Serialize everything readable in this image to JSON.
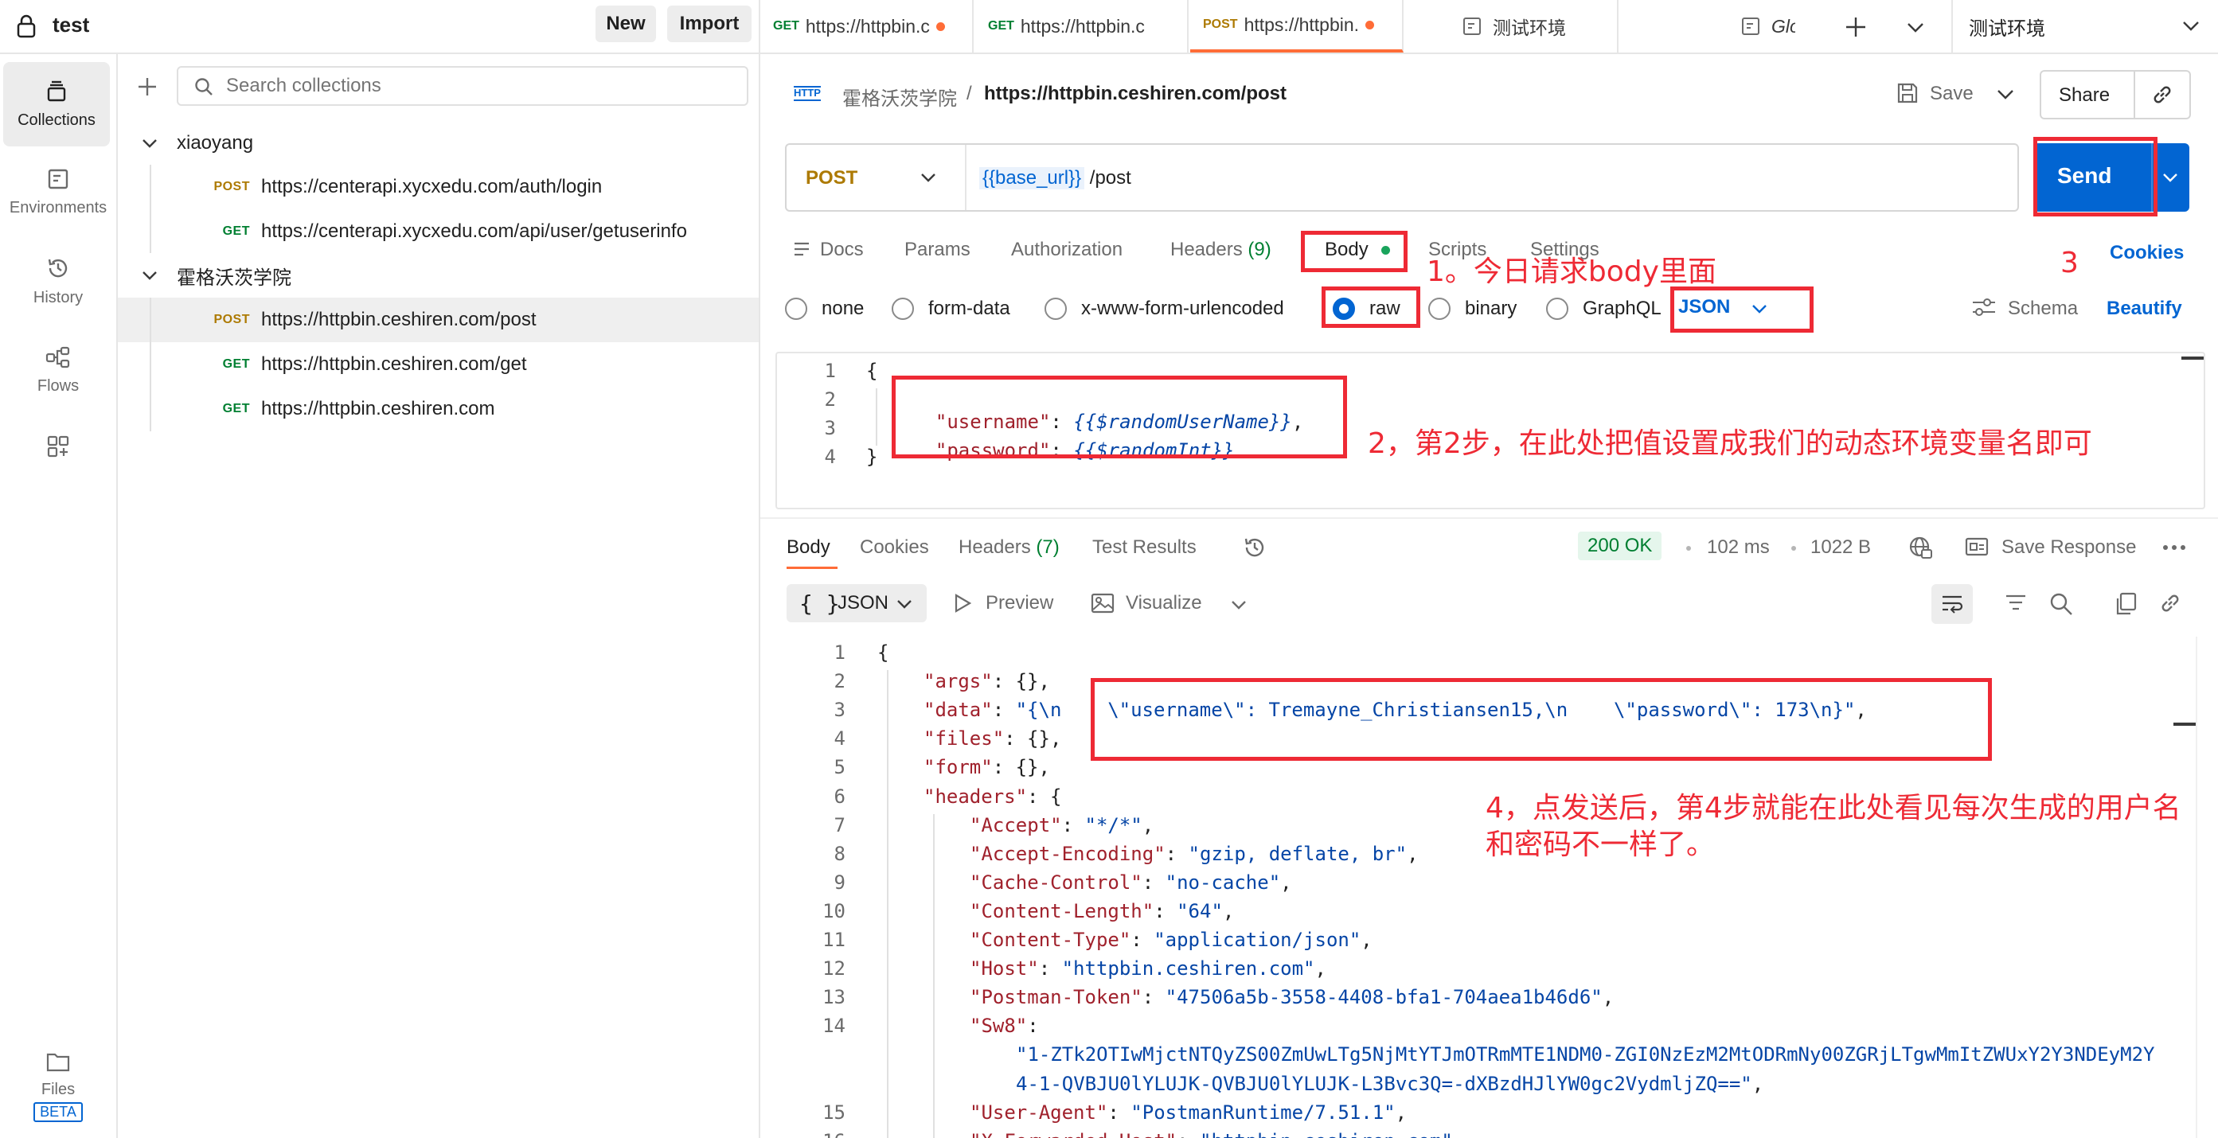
{
  "workspace": {
    "name": "test",
    "new_label": "New",
    "import_label": "Import"
  },
  "rail": {
    "collections": "Collections",
    "environments": "Environments",
    "history": "History",
    "flows": "Flows",
    "files": "Files",
    "beta": "BETA"
  },
  "sidebar": {
    "search_placeholder": "Search collections",
    "folders": [
      {
        "name": "xiaoyang",
        "requests": [
          {
            "method": "POST",
            "url": "https://centerapi.xycxedu.com/auth/login"
          },
          {
            "method": "GET",
            "url": "https://centerapi.xycxedu.com/api/user/getuserinfo"
          }
        ]
      },
      {
        "name": "霍格沃茨学院",
        "requests": [
          {
            "method": "POST",
            "url": "https://httpbin.ceshiren.com/post"
          },
          {
            "method": "GET",
            "url": "https://httpbin.ceshiren.com/get"
          },
          {
            "method": "GET",
            "url": "https://httpbin.ceshiren.com"
          }
        ]
      }
    ]
  },
  "tabs": [
    {
      "method": "GET",
      "label": "https://httpbin.c"
    },
    {
      "method": "GET",
      "label": "https://httpbin.c"
    },
    {
      "method": "POST",
      "label": "https://httpbin."
    }
  ],
  "env_tabs": {
    "env_name": "测试环境",
    "globals": "Globals",
    "selected_env": "测试环境"
  },
  "request": {
    "breadcrumb_collection": "霍格沃茨学院",
    "breadcrumb_sep": "/",
    "breadcrumb_name": "https://httpbin.ceshiren.com/post",
    "http_badge": "HTTP",
    "save_label": "Save",
    "share_label": "Share",
    "method": "POST",
    "url_var": "{{base_url}}",
    "url_path": " /post",
    "send_label": "Send",
    "tabs": {
      "docs": "Docs",
      "params": "Params",
      "authorization": "Authorization",
      "headers": "Headers",
      "headers_count": "(9)",
      "body": "Body",
      "scripts": "Scripts",
      "settings": "Settings",
      "cookies": "Cookies"
    },
    "body_types": {
      "none": "none",
      "form_data": "form-data",
      "urlencoded": "x-www-form-urlencoded",
      "raw": "raw",
      "binary": "binary",
      "graphql": "GraphQL",
      "format": "JSON",
      "schema": "Schema",
      "beautify": "Beautify"
    },
    "body_lines": [
      {
        "n": "1",
        "text": "{"
      },
      {
        "n": "2",
        "key": "\"username\"",
        "sep": ": ",
        "val": "{{$randomUserName}}",
        "end": ","
      },
      {
        "n": "3",
        "key": "\"password\"",
        "sep": ": ",
        "val": "{{$randomInt}}",
        "end": ""
      },
      {
        "n": "4",
        "text": "}"
      }
    ]
  },
  "response": {
    "tabs": {
      "body": "Body",
      "cookies": "Cookies",
      "headers": "Headers",
      "headers_count": "(7)",
      "test_results": "Test Results"
    },
    "status": "200 OK",
    "time": "102 ms",
    "size": "1022 B",
    "save_response": "Save Response",
    "format": "JSON",
    "preview": "Preview",
    "visualize": "Visualize",
    "lines": [
      {
        "n": "1",
        "indent": 0,
        "text": "{"
      },
      {
        "n": "2",
        "indent": 1,
        "key": "\"args\"",
        "rest": ": {},"
      },
      {
        "n": "3",
        "indent": 1,
        "key": "\"data\"",
        "rest_str": "\"{\\n    \\\"username\\\": Tremayne_Christiansen15,\\n    \\\"password\\\": 173\\n}\"",
        "end": ","
      },
      {
        "n": "4",
        "indent": 1,
        "key": "\"files\"",
        "rest": ": {},"
      },
      {
        "n": "5",
        "indent": 1,
        "key": "\"form\"",
        "rest": ": {},"
      },
      {
        "n": "6",
        "indent": 1,
        "key": "\"headers\"",
        "rest": ": {"
      },
      {
        "n": "7",
        "indent": 2,
        "key": "\"Accept\"",
        "rest_str": "\"*/*\"",
        "end": ","
      },
      {
        "n": "8",
        "indent": 2,
        "key": "\"Accept-Encoding\"",
        "rest_str": "\"gzip, deflate, br\"",
        "end": ","
      },
      {
        "n": "9",
        "indent": 2,
        "key": "\"Cache-Control\"",
        "rest_str": "\"no-cache\"",
        "end": ","
      },
      {
        "n": "10",
        "indent": 2,
        "key": "\"Content-Length\"",
        "rest_str": "\"64\"",
        "end": ","
      },
      {
        "n": "11",
        "indent": 2,
        "key": "\"Content-Type\"",
        "rest_str": "\"application/json\"",
        "end": ","
      },
      {
        "n": "12",
        "indent": 2,
        "key": "\"Host\"",
        "rest_str": "\"httpbin.ceshiren.com\"",
        "end": ","
      },
      {
        "n": "13",
        "indent": 2,
        "key": "\"Postman-Token\"",
        "rest_str": "\"47506a5b-3558-4408-bfa1-704aea1b46d6\"",
        "end": ","
      },
      {
        "n": "14",
        "indent": 2,
        "key": "\"Sw8\"",
        "rest": ":"
      },
      {
        "n": "",
        "indent": 3,
        "str": "\"1-ZTk2OTIwMjctNTQyZS00ZmUwLTg5NjMtYTJmOTRmMTE1NDM0-ZGI0NzEzM2MtODRmNy00ZGRjLTgwMmItZWUxY2Y3NDEyM2Y"
      },
      {
        "n": "",
        "indent": 3,
        "str": "4-1-QVBJU0lYLUJK-QVBJU0lYLUJK-L3Bvc3Q=-dXBzdHJlYW0gc2VydmljZQ==\"",
        "end": ","
      },
      {
        "n": "15",
        "indent": 2,
        "key": "\"User-Agent\"",
        "rest_str": "\"PostmanRuntime/7.51.1\"",
        "end": ","
      },
      {
        "n": "16",
        "indent": 2,
        "key": "\"X-Forwarded-Host\"",
        "rest_str": "\"httpbin.ceshiren.com\"",
        "end": ""
      }
    ]
  },
  "annotations": {
    "note1": "1。今日请求body里面",
    "note2": "2，第2步，在此处把值设置成我们的动态环境变量名即可",
    "note3": "3",
    "note4_line1": "4，点发送后，第4步就能在此处看见每次生成的用户名",
    "note4_line2": "和密码不一样了。"
  },
  "colors": {
    "accent": "#ff6c37",
    "send": "#0265d2",
    "annotation": "#ee2a35",
    "post": "#ad7a03",
    "get": "#007f31"
  }
}
